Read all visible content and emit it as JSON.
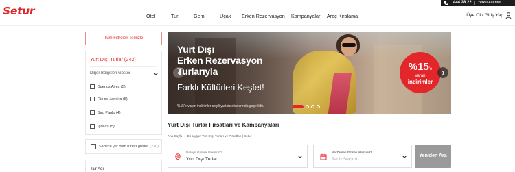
{
  "topbar": {
    "phone": "444 28 22",
    "agent": "Yetkili Acentel"
  },
  "brand": {
    "logo": "Setur"
  },
  "nav": {
    "items": [
      "Otel",
      "Tur",
      "Gemi",
      "Uçak",
      "Erken Rezervasyon",
      "Kampanyalar",
      "Araç Kiralama"
    ],
    "login": "Üye Ol / Giriş Yap"
  },
  "sidebar": {
    "clear_filters": "Tüm Filtreleri Temizle",
    "filter_title": "Yurt Dışı Turlar (242)",
    "region_select": "Diğer Bölgeleri Göster",
    "options": [
      "Buenos Aires (5)",
      "Rio de Janeiro (5)",
      "Sao Paulo (4)",
      "Iguazu (5)"
    ],
    "only_available": "Sadece yer olan turları göster",
    "only_available_count": "(230)",
    "tour_name_label": "Tur Adı"
  },
  "banner": {
    "headline_1": "Yurt Dışı",
    "headline_2": "Erken Rezervasyon",
    "headline_3": "Turlarıyla",
    "subhead": "Farklı Kültürleri Keşfet!",
    "note": "%15'e varan indirimler seçili yurt dışı turlarında geçerlidir.",
    "badge_pct": "%15",
    "badge_suffix": "'e",
    "badge_varan": "varan",
    "badge_indirim": "indirimler",
    "slide_count": 4,
    "active_slide": 1
  },
  "section": {
    "title": "Yurt Dışı Turlar Fırsatları ve Kampanyaları",
    "breadcrumb": [
      "Ana Sayfa",
      "En Uygun Yurt Dışı Turları ve Fırsatları | Setur"
    ]
  },
  "search": {
    "destination_label": "Nereye Gitmek İstersiniz?",
    "destination_value": "Yurt Dışı Turlar",
    "date_label": "Ne Zaman Gitmek İstersiniz?",
    "date_placeholder": "Tarih Seçimi",
    "button": "Yeniden Ara"
  },
  "colors": {
    "brand_red": "#e3262a",
    "button_gray": "#9a9a9a"
  }
}
